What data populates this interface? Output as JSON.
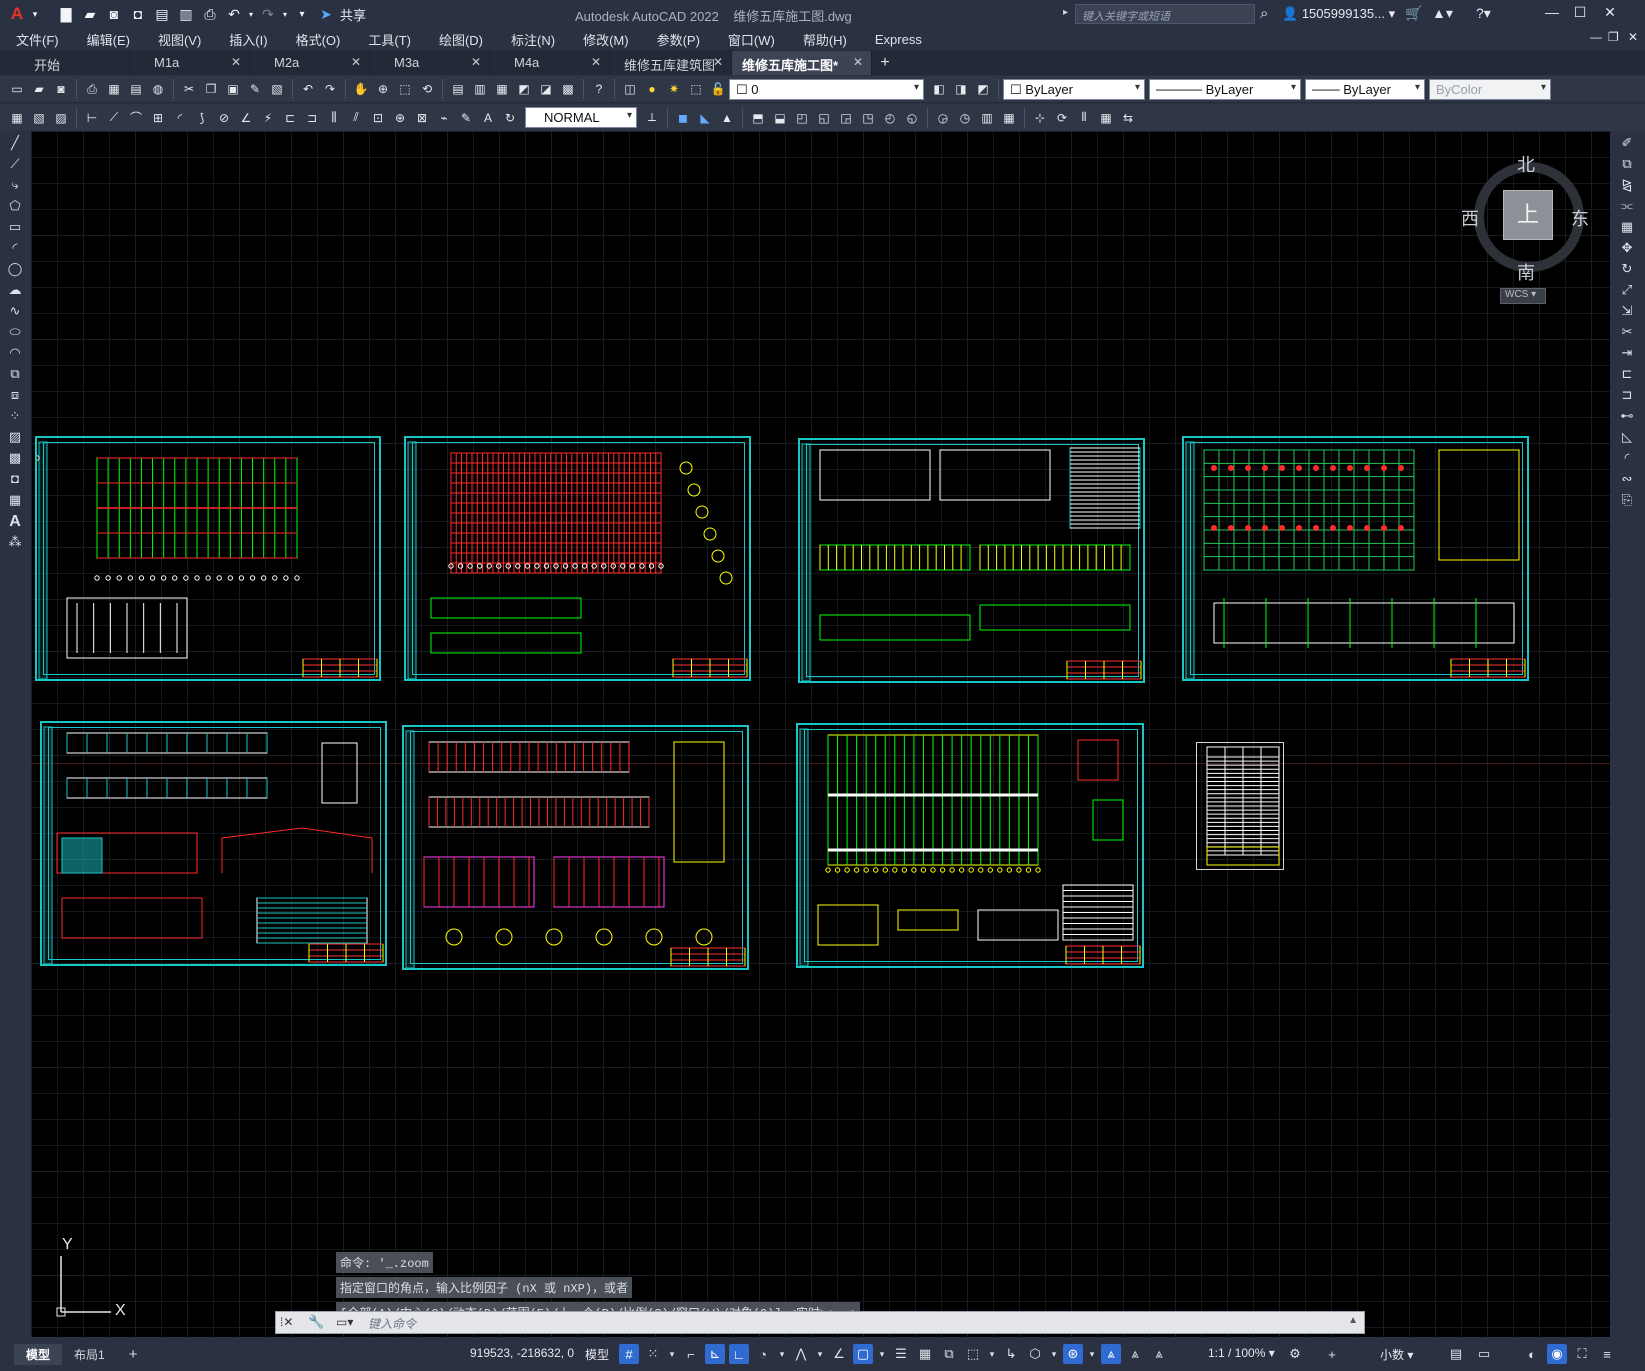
{
  "app": {
    "logo": "A",
    "title": "Autodesk AutoCAD 2022",
    "filename": "维修五库施工图.dwg",
    "share_label": "共享",
    "search_placeholder": "键入关键字或短语",
    "user": "1505999135..."
  },
  "menu": [
    "文件(F)",
    "编辑(E)",
    "视图(V)",
    "插入(I)",
    "格式(O)",
    "工具(T)",
    "绘图(D)",
    "标注(N)",
    "修改(M)",
    "参数(P)",
    "窗口(W)",
    "帮助(H)",
    "Express"
  ],
  "tabs": [
    {
      "label": "开始",
      "active": false
    },
    {
      "label": "M1a",
      "active": false
    },
    {
      "label": "M2a",
      "active": false
    },
    {
      "label": "M3a",
      "active": false
    },
    {
      "label": "M4a",
      "active": false
    },
    {
      "label": "维修五库建筑图",
      "active": false
    },
    {
      "label": "维修五库施工图*",
      "active": true
    }
  ],
  "properties": {
    "layer": "0",
    "color": "ByLayer",
    "linetype": "ByLayer",
    "lineweight": "ByLayer",
    "plotstyle": "ByColor",
    "textstyle": "NORMAL"
  },
  "viewcube": {
    "north": "北",
    "south": "南",
    "east": "东",
    "west": "西",
    "top": "上",
    "wcs": "WCS"
  },
  "ucs": {
    "x": "X",
    "y": "Y"
  },
  "command": {
    "history": [
      "命令: '_.zoom",
      "指定窗口的角点，输入比例因子 (nX 或 nXP)，或者",
      "[全部(A)/中心(C)/动态(D)/范围(E)/上一个(P)/比例(S)/窗口(W)/对象(O)] <实时>: _e"
    ],
    "placeholder": "键入命令"
  },
  "status": {
    "model_tab": "模型",
    "layout_tab": "布局1",
    "coords": "919523, -218632, 0",
    "model_label": "模型",
    "scale": "1:1 / 100%",
    "units": "小数"
  },
  "colors": {
    "background": "#000000",
    "sheet_frame": "#19c6c6",
    "accent": "#2f6bd1"
  }
}
